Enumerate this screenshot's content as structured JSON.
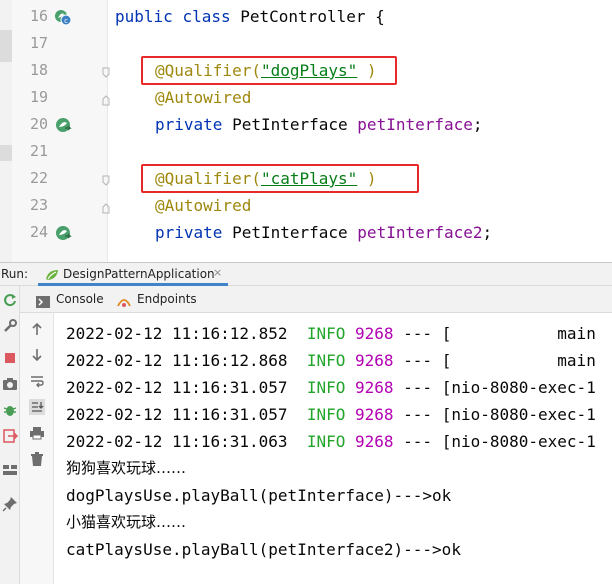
{
  "editor": {
    "lines": [
      {
        "num": "16",
        "kind": "class",
        "kw1": "public",
        "kw2": "class",
        "name": "PetController",
        "brace": " {"
      },
      {
        "num": "17",
        "kind": "blank"
      },
      {
        "num": "18",
        "kind": "qualifier",
        "at": "@Qualifier(",
        "value": "\"dogPlays\"",
        "close": " )"
      },
      {
        "num": "19",
        "kind": "autowired",
        "text": "@Autowired"
      },
      {
        "num": "20",
        "kind": "field",
        "kw": "private",
        "type": " PetInterface ",
        "name": "petInterface",
        "semi": ";"
      },
      {
        "num": "21",
        "kind": "blank"
      },
      {
        "num": "22",
        "kind": "qualifier",
        "at": "@Qualifier(",
        "value": "\"catPlays\"",
        "close": " )"
      },
      {
        "num": "23",
        "kind": "autowired",
        "text": "@Autowired"
      },
      {
        "num": "24",
        "kind": "field",
        "kw": "private",
        "type": " PetInterface ",
        "name": "petInterface2",
        "semi": ";"
      }
    ]
  },
  "run_panel": {
    "label": "Run:",
    "tab": {
      "label": "DesignPatternApplication",
      "close": "×"
    },
    "subtabs": {
      "console": "Console",
      "endpoints": "Endpoints"
    }
  },
  "console": {
    "logs": [
      {
        "time": "2022-02-12 11:16:12.852",
        "level": "INFO",
        "pid": "9268",
        "rest": " --- [           main"
      },
      {
        "time": "2022-02-12 11:16:12.868",
        "level": "INFO",
        "pid": "9268",
        "rest": " --- [           main"
      },
      {
        "time": "2022-02-12 11:16:31.057",
        "level": "INFO",
        "pid": "9268",
        "rest": " --- [nio-8080-exec-1"
      },
      {
        "time": "2022-02-12 11:16:31.057",
        "level": "INFO",
        "pid": "9268",
        "rest": " --- [nio-8080-exec-1"
      },
      {
        "time": "2022-02-12 11:16:31.063",
        "level": "INFO",
        "pid": "9268",
        "rest": " --- [nio-8080-exec-1"
      }
    ],
    "output": [
      "狗狗喜欢玩球……",
      "dogPlaysUse.playBall(petInterface)--->ok",
      "小猫喜欢玩球……",
      "catPlaysUse.playBall(petInterface2)--->ok"
    ]
  },
  "colors": {
    "keyword": "#0033b3",
    "annotation": "#9e880d",
    "string": "#067d17",
    "field": "#871094",
    "log_level": "#22a52a",
    "pid": "#b200b2",
    "highlight_box": "#e8292a",
    "tab_underline": "#4083c9"
  },
  "icons": {
    "line16": "bean-class-icon",
    "line20": "autowired-bean-icon",
    "line24": "autowired-bean-icon",
    "toolbar": [
      "rerun-icon",
      "wrench-icon",
      "stop-icon",
      "camera-icon",
      "bug-icon",
      "exit-icon",
      "layout-icon",
      "pin-icon"
    ],
    "console_tools": [
      "arrow-up-icon",
      "arrow-down-icon",
      "soft-wrap-icon",
      "scroll-to-end-icon",
      "print-icon",
      "trash-icon"
    ]
  }
}
